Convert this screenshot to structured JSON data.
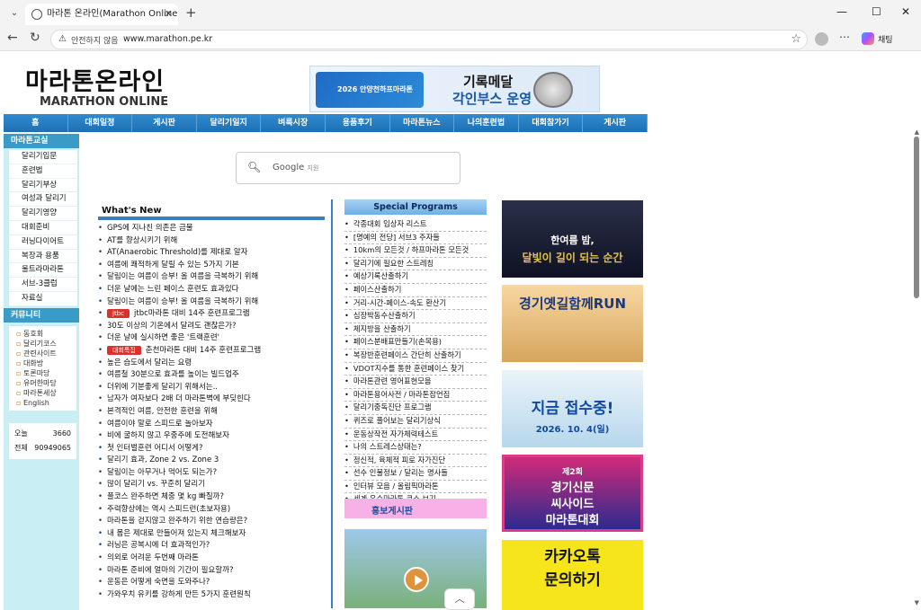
{
  "browser": {
    "tab_title": "마라톤 온라인(Marathon Online in",
    "security_label": "안전하지 않음",
    "url": "www.marathon.pe.kr",
    "copilot_label": "채팅"
  },
  "site": {
    "logo_korean": "마라톤온라인",
    "logo_english": "MARATHON ONLINE",
    "banner": {
      "event": "2026 안양천하프마라톤",
      "line1": "기록메달",
      "line2": "각인부스 운영"
    },
    "menu": [
      "홈",
      "대회일정",
      "게시판",
      "달리기일지",
      "벼룩시장",
      "용품후기",
      "마라톤뉴스",
      "나의훈련법",
      "대회참가기",
      "게시판"
    ]
  },
  "sidebar": {
    "class_title": "마라톤교실",
    "class_items": [
      "달리기입문",
      "훈련법",
      "달리기부상",
      "여성과 달리기",
      "달리기영양",
      "대회준비",
      "러닝다이어트",
      "복장과 용품",
      "울트라마라톤",
      "서브-3클럽",
      "자료실"
    ],
    "community_title": "커뮤니티",
    "community_items": [
      "동호회",
      "달리기코스",
      "관련사이트",
      "대화방",
      "토론마당",
      "유머한마당",
      "마라톤세상",
      "English"
    ],
    "today_label": "오늘",
    "today_value": "3660",
    "total_label": "전체",
    "total_value": "90949065"
  },
  "search": {
    "brand": "Google",
    "suffix": "지원"
  },
  "whats_new": {
    "title": "What's New",
    "items": [
      {
        "text": "GPS에 지나친 의존은 금물"
      },
      {
        "text": "AT를 향상시키기 위해"
      },
      {
        "text": "AT(Anaerobic Threshold)를 제대로 알자"
      },
      {
        "text": "여름에 쾌적하게 달릴 수 있는 5가지 기본"
      },
      {
        "text": "달림이는 여름이 승부! 올 여름을 극복하기 위해"
      },
      {
        "text": "더운 날에는 느린 페이스 훈련도 효과있다"
      },
      {
        "text": "달림이는 여름이 승부! 올 여름을 극복하기 위해"
      },
      {
        "badge": "jtbc",
        "text": "jtbc마라톤 대비 14주 훈련프로그램"
      },
      {
        "text": "30도 이상의 기온에서 달려도 괜찮은가?"
      },
      {
        "text": "더운 날에 실시하면 좋은 '트랙훈련'"
      },
      {
        "badge": "대회특집",
        "text": "춘천마라톤 대비 14주 훈련프로그램"
      },
      {
        "text": "높은 습도에서 달리는 요령"
      },
      {
        "text": "여름철 30분으로 효과를 높이는 빌드업주"
      },
      {
        "text": "더위에 기분좋게 달리기 위해서는.."
      },
      {
        "text": "남자가 여자보다 2배 더 마라톤벽에 부딪힌다"
      },
      {
        "text": "본격적인 여름, 안전한 훈련을 위해"
      },
      {
        "text": "여름이야 말로 스피드로 놀아보자"
      },
      {
        "text": "비에 굴하지 않고 우중주에 도전해보자"
      },
      {
        "text": "첫 인터벌훈련 어디서 어떻게?"
      },
      {
        "text": "달리기 효과, Zone 2 vs. Zone 3"
      },
      {
        "text": "달림이는 아무거나 먹어도 되는가?"
      },
      {
        "text": "많이 달리기 vs. 꾸준히 달리기"
      },
      {
        "text": "풀코스 완주하면 체중 몇 kg 빠질까?"
      },
      {
        "text": "주력향상에는 역시 스피드런(초보자용)"
      },
      {
        "text": "마라톤을 걷지않고 완주하기 위한 연습량은?"
      },
      {
        "text": "내 몸은 제대로 만들어져 있는지 체크해보자"
      },
      {
        "text": "러닝은 공복시에 더 효과적인가?"
      },
      {
        "text": "의외로 어려운 두번째 마라톤"
      },
      {
        "text": "마라톤 준비에 얼마의 기간이 필요할까?"
      },
      {
        "text": "운동은 어떻게 숙면을 도와주나?"
      },
      {
        "text": "가와우치 유키를 강하게 만든 5가지 훈련원칙"
      }
    ]
  },
  "special": {
    "title": "Special Programs",
    "items": [
      "각종대회 입상자 리스트",
      "[명예의 전당] 서브3 주자들",
      "10km의 모든것 / 하프마라톤 모든것",
      "달리기에 필요한 스트레칭",
      "예상기록산출하기",
      "페이스산출하기",
      "거리-시간-페이스-속도 환산기",
      "심장박동수산출하기",
      "체지방을 산출하기",
      "페이스분배표만들기(손목용)",
      "복장반훈련페이스 간단히 산출하기",
      "VDOT지수를 통한 훈련페이스 찾기",
      "마라톤관련 영어표현모음",
      "마라톤용어사전 / 마라톤잡언집",
      "달리기중독진단 프로그램",
      "퀴즈로 풀어보는 달리기상식",
      "운동상작전 자가체력테스트",
      "나의 스트레스상태는?",
      "정신적, 육체적 피로 자가진단",
      "선수 인물정보 / 달리는 명사들",
      "인터뷰 모음 / 올림픽마라톤",
      "세계 유수마라톤 코스 보기"
    ],
    "promo": "홍보게시판"
  },
  "ads": {
    "ad1_line1": "한여름 밤,",
    "ad1_line2": "달빛이 길이 되는 순간",
    "ad2": "경기옛길함께RUN",
    "ad3_line1": "지금 접수중!",
    "ad3_line2": "2026. 10. 4(일)",
    "ad4_line1": "제2회",
    "ad4_line2": "경기신문",
    "ad4_line3": "씨사이드",
    "ad4_line4": "마라톤대회",
    "ad5_line1": "카카오톡",
    "ad5_line2": "문의하기"
  }
}
